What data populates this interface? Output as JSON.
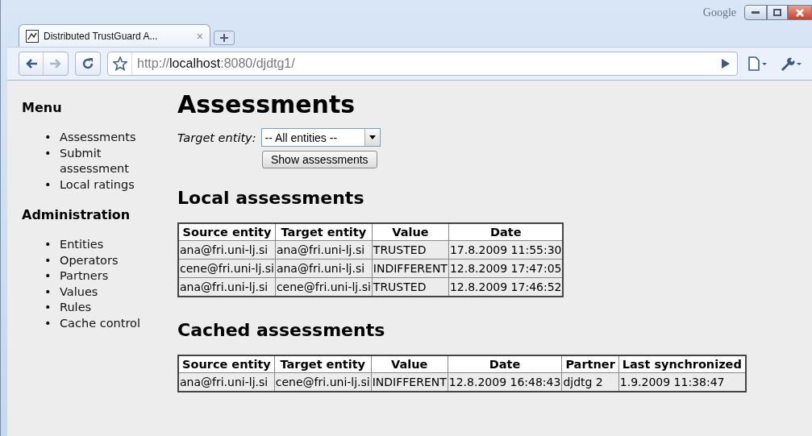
{
  "window": {
    "brand": "Google"
  },
  "tabs": [
    {
      "title": "Distributed TrustGuard A...",
      "close": "×",
      "selected": true
    }
  ],
  "address_bar": {
    "scheme": "http://",
    "host": "localhost",
    "rest": ":8080/djdtg1/"
  },
  "sidebar": {
    "sections": [
      {
        "heading": "Menu",
        "bullet": "•",
        "items": [
          "Assessments",
          "Submit assessment",
          "Local ratings"
        ]
      },
      {
        "heading": "Administration",
        "bullet": "•",
        "items": [
          "Entities",
          "Operators",
          "Partners",
          "Values",
          "Rules",
          "Cache control"
        ]
      }
    ]
  },
  "page": {
    "title": "Assessments",
    "filter_label": "Target entity:",
    "filter_value": "-- All entities --",
    "button": "Show assessments"
  },
  "tables": [
    {
      "title": "Local assessments",
      "columns": [
        "Source entity",
        "Target entity",
        "Value",
        "Date"
      ],
      "rows": [
        [
          "ana@fri.uni-lj.si",
          "ana@fri.uni-lj.si",
          "TRUSTED",
          "17.8.2009 11:55:30"
        ],
        [
          "cene@fri.uni-lj.si",
          "ana@fri.uni-lj.si",
          "INDIFFERENT",
          "12.8.2009 17:47:05"
        ],
        [
          "ana@fri.uni-lj.si",
          "cene@fri.uni-lj.si",
          "TRUSTED",
          "12.8.2009 17:46:52"
        ]
      ]
    },
    {
      "title": "Cached assessments",
      "columns": [
        "Source entity",
        "Target entity",
        "Value",
        "Date",
        "Partner",
        "Last synchronized"
      ],
      "rows": [
        [
          "ana@fri.uni-lj.si",
          "cene@fri.uni-lj.si",
          "INDIFFERENT",
          "12.8.2009 16:48:43",
          "djdtg 2",
          "1.9.2009 11:38:47"
        ]
      ]
    }
  ]
}
